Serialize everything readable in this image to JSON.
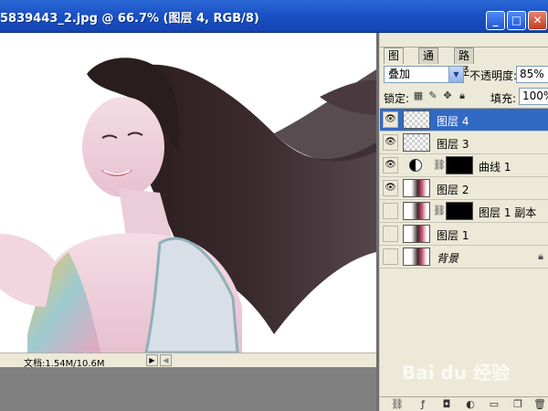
{
  "window": {
    "title": "5839443_2.jpg @ 66.7% (图层 4, RGB/8)",
    "minimize_glyph": "_",
    "maximize_glyph": "□",
    "close_glyph": "✕"
  },
  "status": {
    "doc_info": "文档:1.54M/10.6M"
  },
  "panel": {
    "tabs": [
      "图层",
      "通道",
      "路径"
    ],
    "blend_mode": "叠加",
    "opacity_label": "不透明度:",
    "opacity_value": "85%",
    "lock_label": "锁定:",
    "fill_label": "填充:",
    "fill_value": "100%",
    "layers": [
      {
        "name": "图层 4",
        "selected": true,
        "visible": true
      },
      {
        "name": "图层 3",
        "selected": false,
        "visible": true
      },
      {
        "name": "曲线 1",
        "selected": false,
        "visible": true
      },
      {
        "name": "图层 2",
        "selected": false,
        "visible": true
      },
      {
        "name": "图层 1 副本",
        "selected": false,
        "visible": false
      },
      {
        "name": "图层 1",
        "selected": false,
        "visible": false
      },
      {
        "name": "背景",
        "selected": false,
        "visible": false
      }
    ]
  },
  "watermark": "Bai du 经验",
  "colors": {
    "titlebar": "#1b52c6",
    "selected_layer": "#316ac5",
    "panel_bg": "#ece9d8"
  }
}
